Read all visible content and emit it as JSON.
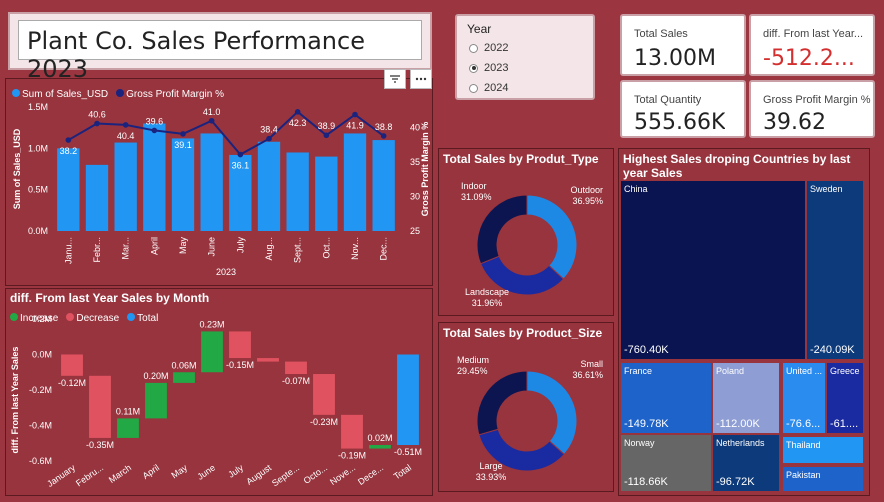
{
  "title": "Plant Co. Sales Performance 2023",
  "year_slicer": {
    "label": "Year",
    "options": [
      "2022",
      "2023",
      "2024"
    ],
    "selected": "2023"
  },
  "cards": {
    "total_sales": {
      "label": "Total Sales",
      "value": "13.00M"
    },
    "diff_last_year": {
      "label": "diff. From last Year...",
      "value": "-512.2..."
    },
    "total_quantity": {
      "label": "Total Quantity",
      "value": "555.66K"
    },
    "gross_profit_margin": {
      "label": "Gross Profit Margin %",
      "value": "39.62"
    }
  },
  "toolbar": {
    "filter_icon": "filter-icon",
    "more_icon": "more-options-icon"
  },
  "colors": {
    "bar": "#2196f3",
    "line": "#1a237e",
    "increase": "#22a845",
    "decrease": "#e05260",
    "total": "#2196f3"
  },
  "chart_data": [
    {
      "type": "bar",
      "legend": [
        "Sum of Sales_USD",
        "Gross Profit Margin %"
      ],
      "xlabel": "2023",
      "ylabel": "Sum of Sales_USD",
      "y2label": "Gross Profit Margin %",
      "categories": [
        "Janu...",
        "Febr...",
        "Mar...",
        "April",
        "May",
        "June",
        "July",
        "Aug...",
        "Sept...",
        "Oct...",
        "Nov...",
        "Dec..."
      ],
      "yticks": [
        "0.0M",
        "0.5M",
        "1.0M",
        "1.5M"
      ],
      "y2ticks": [
        "25",
        "30",
        "35",
        "40"
      ],
      "ylim": [
        0,
        1.5
      ],
      "y2lim": [
        25,
        43
      ],
      "series": [
        {
          "name": "Sum of Sales_USD",
          "values": [
            1.0,
            0.8,
            1.07,
            1.3,
            1.12,
            1.18,
            0.92,
            1.08,
            0.95,
            0.9,
            1.18,
            1.1
          ]
        },
        {
          "name": "Gross Profit Margin %",
          "values": [
            38.2,
            40.6,
            40.4,
            39.6,
            39.1,
            41.0,
            36.1,
            38.4,
            42.3,
            38.9,
            41.9,
            38.8
          ]
        }
      ],
      "line_labels": [
        "38.2",
        "40.6",
        "40.4",
        "39.6",
        "39.1",
        "41.0",
        "36.1",
        "38.4",
        "42.3",
        "38.9",
        "41.9",
        "38.8"
      ]
    },
    {
      "type": "bar",
      "subtype": "waterfall",
      "title": "diff. From last Year Sales by Month",
      "legend": [
        "Increase",
        "Decrease",
        "Total"
      ],
      "ylabel": "diff. From last Year Sales",
      "yticks": [
        "0.2M",
        "0.0M",
        "-0.2M",
        "-0.4M",
        "-0.6M"
      ],
      "ylim": [
        -0.6,
        0.2
      ],
      "categories": [
        "January",
        "Febru...",
        "March",
        "April",
        "May",
        "June",
        "July",
        "August",
        "Septe...",
        "Octo...",
        "Nove...",
        "Dece...",
        "Total"
      ],
      "values": [
        -0.12,
        -0.35,
        0.11,
        0.2,
        0.06,
        0.23,
        -0.15,
        -0.02,
        -0.07,
        -0.23,
        -0.19,
        0.02,
        -0.51
      ],
      "labels": [
        "-0.12M",
        "-0.35M",
        "0.11M",
        "0.20M",
        "0.06M",
        "0.23M",
        "-0.15M",
        "",
        "-0.07M",
        "-0.23M",
        "-0.19M",
        "0.02M",
        "-0.51M"
      ]
    },
    {
      "type": "pie",
      "title": "Total Sales by Produt_Type",
      "slices": [
        {
          "name": "Outdoor",
          "value": 36.95,
          "label": "36.95%",
          "color": "#1e88e5"
        },
        {
          "name": "Landscape",
          "value": 31.96,
          "label": "31.96%",
          "color": "#1a2aa0"
        },
        {
          "name": "Indoor",
          "value": 31.09,
          "label": "31.09%",
          "color": "#0d1550"
        }
      ]
    },
    {
      "type": "pie",
      "title": "Total Sales by Product_Size",
      "slices": [
        {
          "name": "Small",
          "value": 36.61,
          "label": "36.61%",
          "color": "#1e88e5"
        },
        {
          "name": "Large",
          "value": 33.93,
          "label": "33.93%",
          "color": "#1a2aa0"
        },
        {
          "name": "Medium",
          "value": 29.45,
          "label": "29.45%",
          "color": "#0d1550"
        }
      ]
    },
    {
      "type": "heatmap",
      "subtype": "treemap",
      "title": "Highest Sales droping Countries by last year Sales",
      "items": [
        {
          "name": "China",
          "value": "-760.40K"
        },
        {
          "name": "Sweden",
          "value": "-240.09K"
        },
        {
          "name": "France",
          "value": "-149.78K"
        },
        {
          "name": "Poland",
          "value": "-112.00K"
        },
        {
          "name": "United ...",
          "value": "-76.6..."
        },
        {
          "name": "Greece",
          "value": "-61...."
        },
        {
          "name": "Norway",
          "value": "-118.66K"
        },
        {
          "name": "Netherlands",
          "value": "-96.72K"
        },
        {
          "name": "Thailand",
          "value": ""
        },
        {
          "name": "Pakistan",
          "value": ""
        }
      ]
    }
  ]
}
